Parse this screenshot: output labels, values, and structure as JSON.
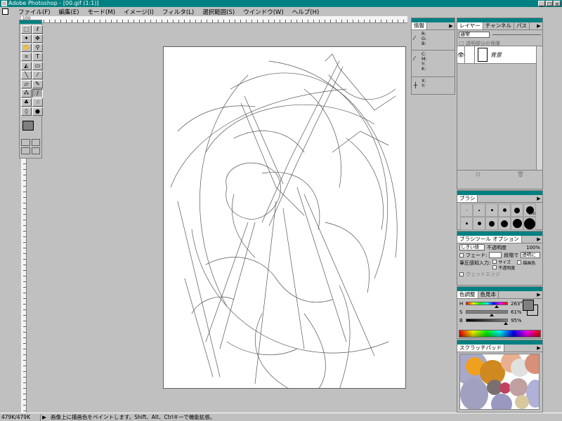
{
  "window": {
    "title": "Adobe Photoshop - [00.gif (1:1)]"
  },
  "menu": [
    "ファイル(F)",
    "編集(E)",
    "モード(M)",
    "イメージ(I)",
    "フィルタ(L)",
    "選択範囲(S)",
    "ウインドウ(W)",
    "ヘルプ(H)"
  ],
  "ruler": {
    "origin_label": "100"
  },
  "info_palette": {
    "tab": "情報",
    "rgb_labels": "R:\nG:\nB:",
    "cmyk_labels": "C:\nM:\nY:\nK:",
    "xy_labels": "X:\nY:"
  },
  "layers_palette": {
    "tabs": [
      "レイヤー",
      "チャンネル",
      "パス"
    ],
    "blend_mode": "通常",
    "preserve_label": "□ 透明部分の保護",
    "layers": [
      {
        "name": "背景",
        "visible": true
      }
    ],
    "footer_icons": [
      "new-layer-icon",
      "trash-icon"
    ]
  },
  "brushes_palette": {
    "tab": "ブラシ",
    "brush_sizes": [
      1,
      3,
      5,
      9,
      13,
      19,
      5,
      9,
      13,
      17,
      21,
      27
    ],
    "large_brush_label": "100"
  },
  "options_palette": {
    "tab": "ブラシツール オプション",
    "mode": "しきい値",
    "opacity_label": "不透明度",
    "opacity_value": "100%",
    "fade_label": "フェード:",
    "fade_steps_label": "段階で",
    "fade_to": "透明に",
    "stylus_label": "筆圧感知入力:",
    "stylus_size": "サイズ",
    "stylus_opacity": "不透明度",
    "stylus_color": "描画色",
    "wet_edges": "ウェットエッジ"
  },
  "color_palette": {
    "tabs": [
      "色調整",
      "色見本"
    ],
    "h": {
      "label": "H",
      "value": 263,
      "display": "263",
      "unit": "°"
    },
    "s": {
      "label": "S",
      "value": 61,
      "display": "61",
      "unit": "%"
    },
    "b": {
      "label": "B",
      "value": 95,
      "display": "95",
      "unit": "%"
    }
  },
  "scratch_palette": {
    "tab": "スクラッチパッド"
  },
  "status": {
    "doc_size": "479K/479K",
    "message": "画像上に描画色をペイントします。Shift、Alt、Ctrlキーで機能拡張。"
  },
  "colors": {
    "title_bar": "#008080",
    "chrome": "#c0c0c0",
    "foreground": "#808080",
    "background": "#ffffff"
  },
  "tools": [
    "marquee-tool",
    "lasso-tool",
    "magic-wand-tool",
    "move-tool",
    "hand-tool",
    "zoom-tool",
    "crop-tool",
    "type-tool",
    "paint-bucket-tool",
    "gradient-tool",
    "line-tool",
    "eyedropper-tool",
    "eraser-tool",
    "pencil-tool",
    "airbrush-tool",
    "paintbrush-tool",
    "rubber-stamp-tool",
    "smudge-tool",
    "blur-tool",
    "dodge-tool"
  ]
}
